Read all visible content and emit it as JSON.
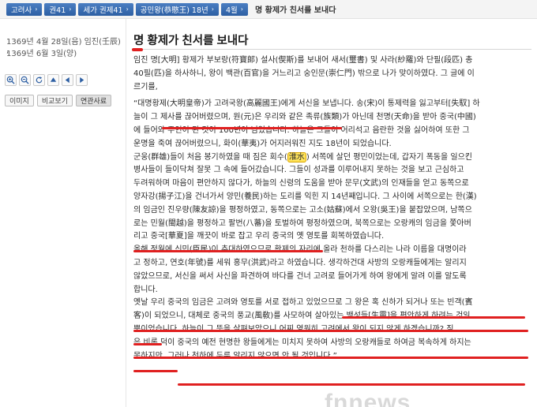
{
  "breadcrumb": [
    {
      "label": "고려사"
    },
    {
      "label": "권41"
    },
    {
      "label": "세가 권제41"
    },
    {
      "label": "공민왕(恭愍王) 18년"
    },
    {
      "label": "4월"
    },
    {
      "label": "명 황제가 친서를 보내다"
    }
  ],
  "dates": {
    "line1": "1369년 4월 28일(음) 임진(壬辰) ,",
    "line2": "1369년 6월 3일(양)"
  },
  "toolbar": {
    "icons": [
      "zoom-in-icon",
      "zoom-out-icon",
      "refresh-icon",
      "arrow-up-icon",
      "arrow-left-icon",
      "arrow-right-icon"
    ]
  },
  "tabs": [
    {
      "label": "이미지",
      "active": false
    },
    {
      "label": "비교보기",
      "active": false
    },
    {
      "label": "연관사료",
      "active": true
    }
  ],
  "article": {
    "title": "명 황제가 친서를 보내다",
    "lines": [
      "임진 명[大明] 황제가 부보랑(符寶郞) 설사(偰斯)를 보내어 새서(璽書) 및 사라(紗羅)와 단필(段匹) 총",
      "40필(匹)을 하사하니, 왕이 백관(百官)을 거느리고 숭인문(崇仁門) 밖으로 나가 맞이하였다. 그 글에 이",
      "르기를,",
      "",
      "“대명황제(大明皇帝)가 고려국왕(高麗國王)에게 서신을 보냅니다. 송(宋)이 통제력을 잃고부터[失馭] 하",
      "늘이 그 제사를 끊어버렸으며, 원(元)은 우리와 같은 족류(族類)가 아닌데 천명(天命)을 받아 중국(中國)",
      "에 들어와 주인이 된 것이 100년이 넘었습니다. 하늘은 그들이 어리석고 음란한 것을 싫어하여 또한 그",
      "운명을 죽여 끊어버렸으니, 화이(華夷)가 어지러워진 지도 18년이 되었습니다.",
      "군웅(群雄)들이 처음 봉기하였을 때 짐은 회수(",
      "병사들이 들이닥쳐 잘못 그 속에 들어갔습니다. 그들이 성과를 이루어내지 못하는 것을 보고 근심하고",
      "두려워하며 마음이 편안하지 않다가, 하늘의 신령의 도움을 받아 문무(文武)의 인재들을 얻고 동쪽으로",
      "양자강(揚子江)을 건너가서 양민(養民)하는 도리를 익힌 지 14년째입니다. 그 사이에 서쪽으로는 한(漢)",
      "의 임금인 진우량(陳友諒)을 평정하였고, 동쪽으로는 고소(姑蘇)에서 오왕(吳王)을 붙잡았으며, 남쪽으",
      "로는 민월(閩越)을 평정하고 팔번(八蕃)을 토벌하여 평정하였으며, 북쪽으로는 오랑캐의 임금을 쫓아버",
      "리고 중국[華夏]을 깨끗이 바로 잡고 우리 중국의 옛 영토를 회복하였습니다.",
      "올해 정월에 신민(臣民)이 추대하였으므로 황제의 자리에 올라 천하를 다스리는 나라 이름을 대명이라",
      "고 정하고, 연호(年號)를 세워 홍무(洪武)라고 하였습니다. 생각하건대 사방의 오랑캐들에게는 알리지",
      "않았으므로, 서신을 써서 사신을 파견하여 바다를 건너 고려로 들어가게 하여 왕에게 알려 이를 알도록",
      "합니다.",
      "옛날 우리 중국의 임금은 고려와 영토를 서로 접하고 있었으므로 그 왕은 혹 신하가 되거나 또는 빈객(賓",
      "客)이 되었으니, 대체로 중국의 풍교(風敎)를 사모하여 살아있는 백성들[生靈]을 편안하게 하려는 것일",
      "뿐이었습니다. 하늘이 그 뜻을 살펴보았으니 어찌 영원히 고려에서 왕이 되지 않게 하겠습니까? 짐",
      "은 비록 덕이 중국의 예전 현명한 왕들에게는 미치지 못하여 사방의 오랑캐들로 하여금 복속하게 하지는",
      "못하지만, 그러나 천하에 두루 알리지 않으면 안 될 것입니다.”"
    ],
    "line9_highlight": "淮水",
    "line9_rest": ") 서쪽에 살던 평민이었는데, 갑자기 폭동을 일으킨"
  },
  "watermark": "fnnews"
}
